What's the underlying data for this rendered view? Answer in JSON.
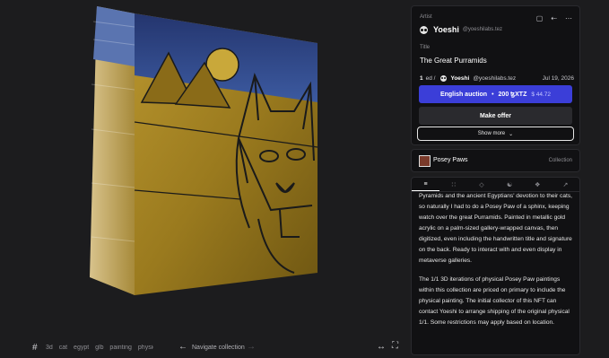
{
  "artist": {
    "label": "Artist",
    "name": "Yoeshi",
    "handle": "@yoeshilabs.tez"
  },
  "artwork_title": {
    "label": "Title",
    "value": "The Great Purramids"
  },
  "edition": {
    "count": "1",
    "unit": "ed /",
    "artist": "Yoeshi",
    "handle": "@yoeshilabs.tez",
    "date": "Jul 19, 2026"
  },
  "auction": {
    "label": "English auction",
    "separator": "•",
    "price": "200 ꜩXTZ",
    "usd": "$ 44.72"
  },
  "offer_label": "Make offer",
  "show_more_label": "Show more",
  "collection": {
    "name": "Posey Paws",
    "tag": "Collection"
  },
  "description": {
    "paragraph_1": "or the Nubian Sphinx, lies intimately with the Great Pyramids and the ancient Egyptians' devotion to their cats, so naturally I had to do a Posey Paw of a sphinx, keeping watch over the great Purramids. Painted in metallic gold acrylic on a palm-sized gallery-wrapped canvas, then digitized, even including the handwritten title and signature on the back. Ready to interact with and even display in metaverse galleries.",
    "paragraph_2": "The 1/1 3D iterations of physical Posey Paw paintings within this collection are priced on primary to include the physical painting. The initial collector of this NFT can contact Yoeshi to arrange shipping of the original physical 1/1. Some restrictions may apply based on location."
  },
  "tags": [
    "3d",
    "cat",
    "egypt",
    "glb",
    "painting",
    "physical",
    "pu"
  ],
  "navigation": {
    "label": "Navigate collection"
  },
  "colors": {
    "accent": "#3b3ed8",
    "background": "#1c1c1e",
    "card": "#111113"
  },
  "icons": {
    "hash": "hash-icon",
    "prev": "arrow-left-icon",
    "next": "arrow-right-icon",
    "fit": "fit-view-icon",
    "fullscreen": "fullscreen-icon",
    "save": "bookmark-icon",
    "share": "share-icon",
    "more": "more-icon"
  }
}
